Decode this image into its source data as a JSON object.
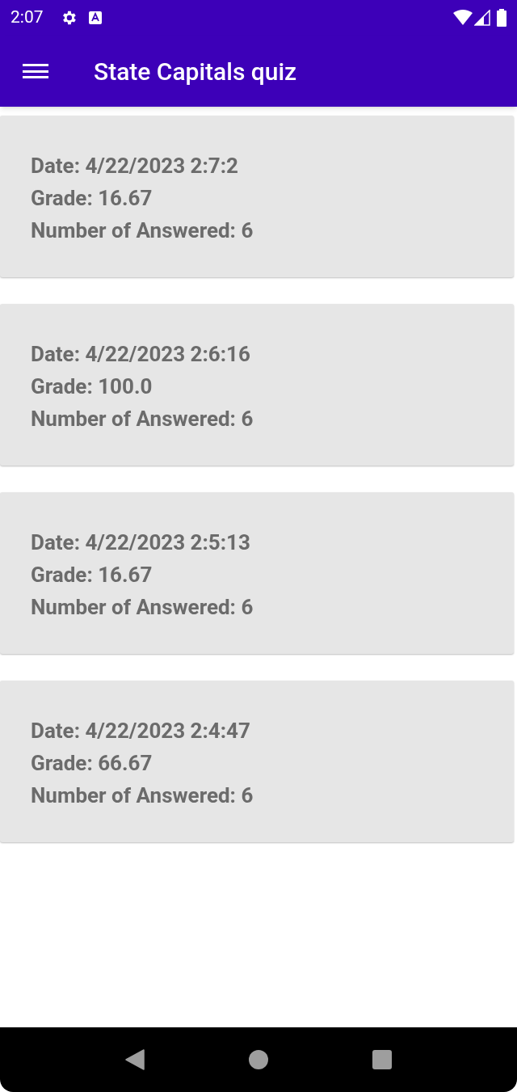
{
  "status_bar": {
    "time": "2:07"
  },
  "app_bar": {
    "title": "State Capitals quiz"
  },
  "results": [
    {
      "date": "Date: 4/22/2023 2:7:2",
      "grade": "Grade: 16.67",
      "answered": "Number of Answered: 6"
    },
    {
      "date": "Date: 4/22/2023 2:6:16",
      "grade": "Grade: 100.0",
      "answered": "Number of Answered: 6"
    },
    {
      "date": "Date: 4/22/2023 2:5:13",
      "grade": "Grade: 16.67",
      "answered": "Number of Answered: 6"
    },
    {
      "date": "Date: 4/22/2023 2:4:47",
      "grade": "Grade: 66.67",
      "answered": "Number of Answered: 6"
    }
  ]
}
